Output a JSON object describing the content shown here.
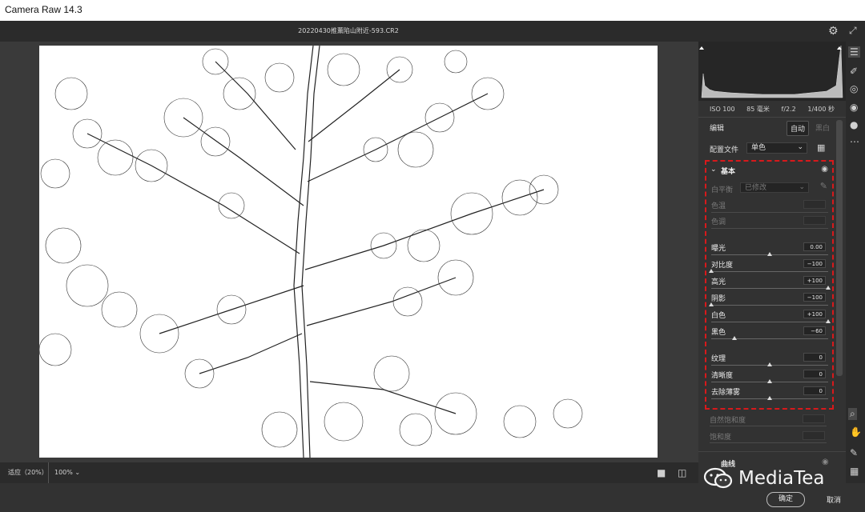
{
  "window": {
    "title": "Camera Raw 14.3"
  },
  "topbar": {
    "filename": "20220430推薰陷山附近-593.CR2"
  },
  "camera_info": {
    "iso": "ISO 100",
    "focal": "85 毫米",
    "aperture": "f/2.2",
    "shutter": "1/400 秒"
  },
  "edit": {
    "title": "编辑",
    "auto_label": "自动",
    "bw_label": "黑白",
    "profile_label": "配置文件",
    "profile_value": "单色"
  },
  "basic": {
    "section_title": "基本",
    "white_balance": {
      "label": "白平衡",
      "value": "已修改"
    },
    "temp": {
      "label": "色温"
    },
    "tint": {
      "label": "色调"
    },
    "sliders": [
      {
        "label": "曝光",
        "value": "0.00",
        "position": 0.5
      },
      {
        "label": "对比度",
        "value": "−100",
        "position": 0.0
      },
      {
        "label": "高光",
        "value": "+100",
        "position": 1.0
      },
      {
        "label": "阴影",
        "value": "−100",
        "position": 0.0
      },
      {
        "label": "白色",
        "value": "+100",
        "position": 1.0
      },
      {
        "label": "黑色",
        "value": "−60",
        "position": 0.2
      },
      {
        "label": "纹理",
        "value": "0",
        "position": 0.5
      },
      {
        "label": "清晰度",
        "value": "0",
        "position": 0.5
      },
      {
        "label": "去除薄雾",
        "value": "0",
        "position": 0.5
      }
    ],
    "vibrance": {
      "label": "自然饱和度"
    },
    "saturation": {
      "label": "饱和度"
    }
  },
  "curve": {
    "title": "曲线"
  },
  "bottombar": {
    "zoom_fit": "适应（20%）",
    "zoom_level": "100%"
  },
  "footer": {
    "ok": "确定",
    "cancel": "取消"
  },
  "watermark": {
    "text": "MediaTea"
  },
  "colors": {
    "highlight_box": "#d8191b",
    "panel_bg": "#323232",
    "photo_bg": "#ffffff"
  }
}
